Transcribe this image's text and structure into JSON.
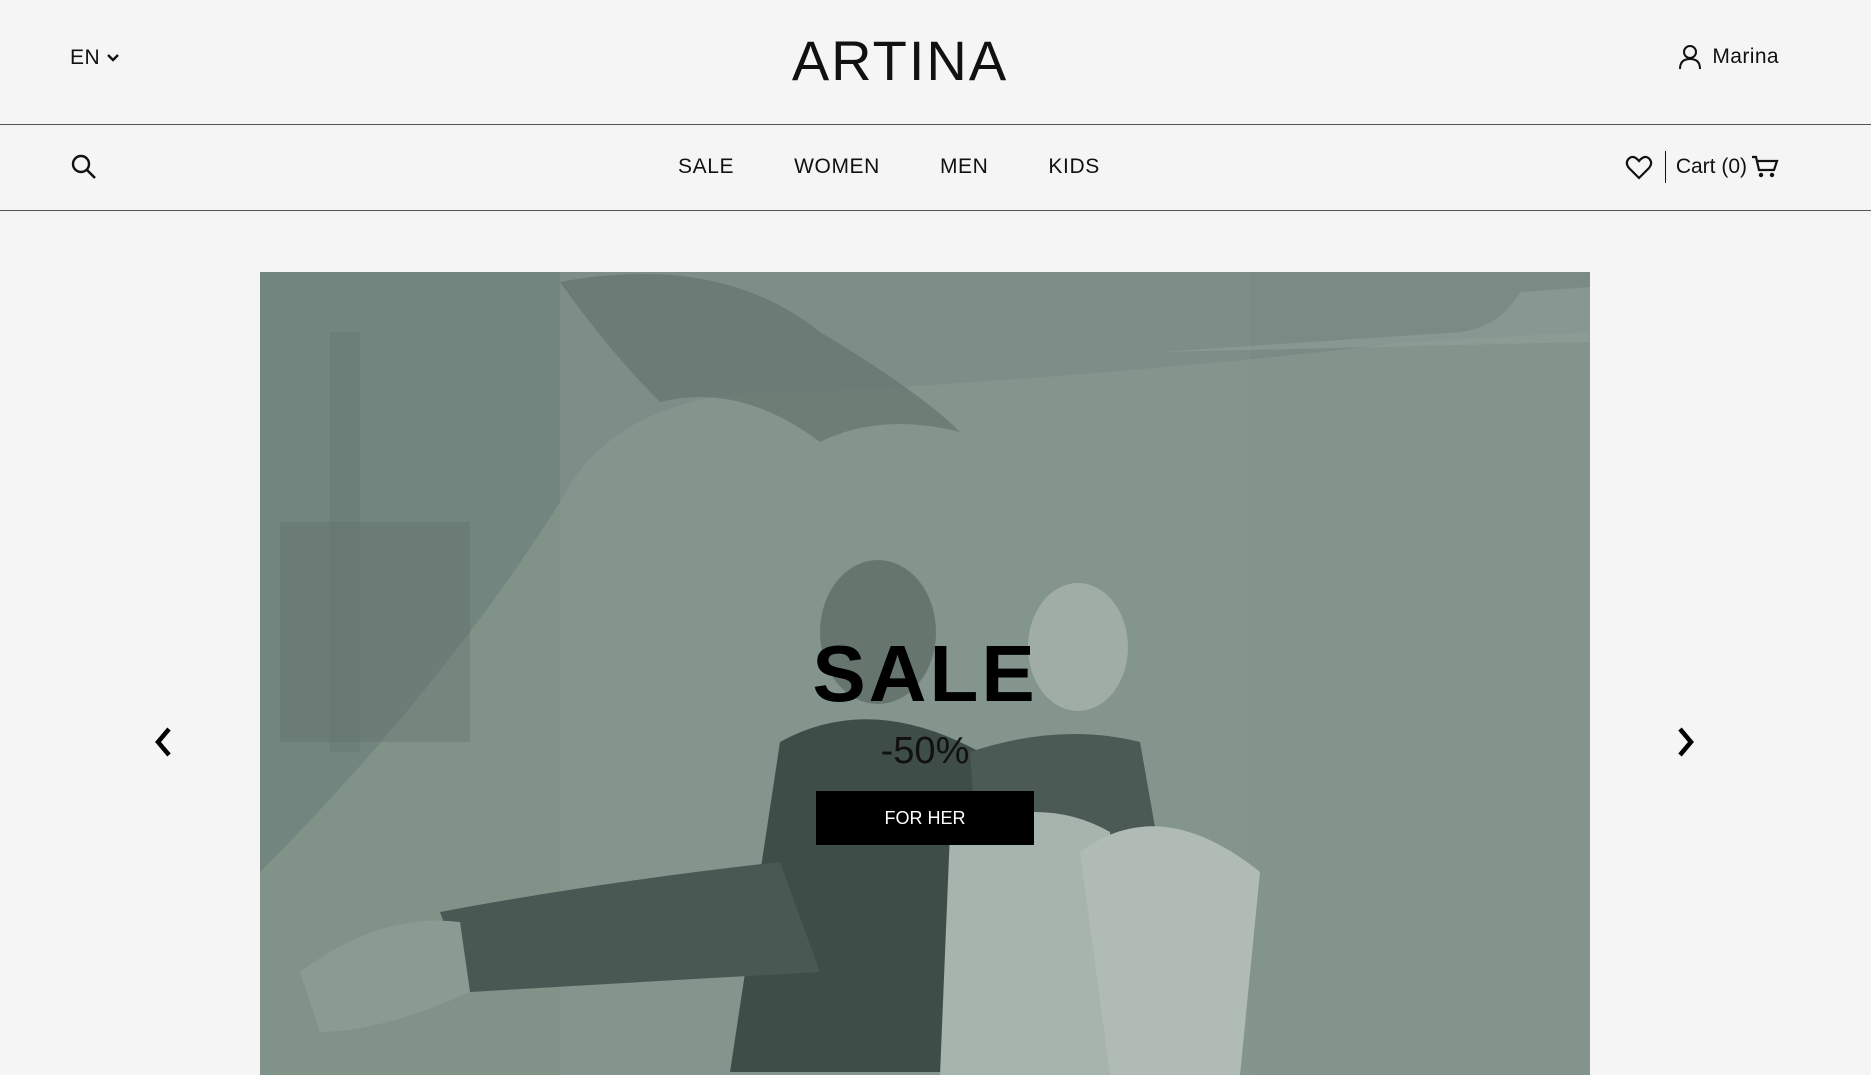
{
  "header": {
    "language": "EN",
    "brand": "ARTINA",
    "user_name": "Marina"
  },
  "nav": {
    "items": [
      {
        "label": "SALE"
      },
      {
        "label": "WOMEN"
      },
      {
        "label": "MEN"
      },
      {
        "label": "KIDS"
      }
    ],
    "cart_label": "Cart (0)"
  },
  "hero": {
    "title": "SALE",
    "subtitle": "-50%",
    "cta_label": "FOR HER"
  },
  "colors": {
    "background": "#f5f5f5",
    "hero_tint": "#7d8e89",
    "text": "#111111",
    "button_bg": "#000000",
    "button_text": "#ffffff"
  },
  "icons": {
    "language_dropdown": "chevron-down-icon",
    "user": "user-icon",
    "search": "search-icon",
    "wishlist": "heart-icon",
    "cart": "cart-icon",
    "prev": "chevron-left-icon",
    "next": "chevron-right-icon"
  }
}
